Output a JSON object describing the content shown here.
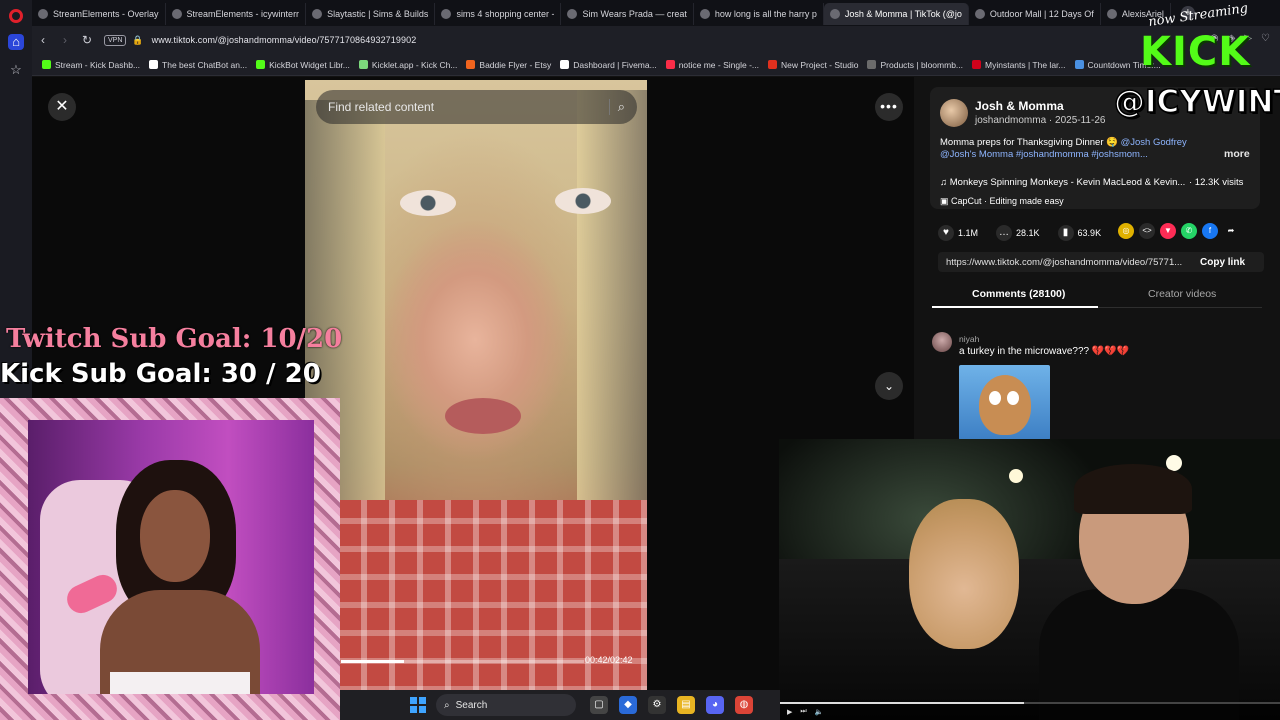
{
  "browser": {
    "tabs": [
      {
        "label": "StreamElements - Overlay",
        "active": false
      },
      {
        "label": "StreamElements - icywinterr",
        "active": false
      },
      {
        "label": "Slaytastic | Sims & Builds",
        "active": false
      },
      {
        "label": "sims 4 shopping center -",
        "active": false
      },
      {
        "label": "Sim Wears Prada — creat",
        "active": false
      },
      {
        "label": "how long is all the harry p",
        "active": false
      },
      {
        "label": "Josh & Momma | TikTok (@jo",
        "active": true
      },
      {
        "label": "Outdoor Mall | 12 Days Of",
        "active": false
      },
      {
        "label": "AlexisAriel",
        "active": false
      }
    ],
    "new_tab": "+",
    "vpn_label": "VPN",
    "url": "www.tiktok.com/@joshandmomma/video/7577170864932719902",
    "bookmarks": [
      {
        "label": "Stream - Kick Dashb...",
        "color": "#53fc18"
      },
      {
        "label": "The best ChatBot an...",
        "color": "#ffffff"
      },
      {
        "label": "KickBot Widget Libr...",
        "color": "#53fc18"
      },
      {
        "label": "Kicklet.app - Kick Ch...",
        "color": "#7cd97c"
      },
      {
        "label": "Baddie Flyer - Etsy",
        "color": "#f1641e"
      },
      {
        "label": "Dashboard | Fivema...",
        "color": "#ffffff"
      },
      {
        "label": "notice me - Single -...",
        "color": "#fa2d48"
      },
      {
        "label": "New Project - Studio",
        "color": "#e0301e"
      },
      {
        "label": "Products | bloommb...",
        "color": "#6b6b6b"
      },
      {
        "label": "Myinstants | The lar...",
        "color": "#d0021b"
      },
      {
        "label": "Countdown Timer...",
        "color": "#4a90e2"
      }
    ]
  },
  "tiktok": {
    "search_placeholder": "Find related content",
    "progress_fraction": 0.26,
    "timecode": "00:42/02:42",
    "author_name": "Josh & Momma",
    "author_handle": "joshandmomma · 2025-11-26",
    "caption_text": "Momma preps for Thanksgiving Dinner 🤤 ",
    "caption_tags_line1": "@Josh Godfrey",
    "caption_tags_line2": "@Josh's Momma #joshandmomma #joshsmom...",
    "more_label": "more",
    "music": "♫  Monkeys Spinning Monkeys - Kevin MacLeod & Kevin...",
    "visits": "· 12.3K visits",
    "capcut": "CapCut · Editing made easy",
    "likes": "1.1M",
    "comments_count": "28.1K",
    "saves": "63.9K",
    "share_link": "https://www.tiktok.com/@joshandmomma/video/75771...",
    "copy_link_label": "Copy link",
    "tab_comments": "Comments (28100)",
    "tab_creator": "Creator videos",
    "comment": {
      "user": "niyah",
      "text": "a turkey in the microwave??? 💔💔💔"
    }
  },
  "overlay": {
    "twitch_goal": "Twitch Sub Goal: 10/20",
    "kick_goal": "Kick Sub Goal: 30 / 20",
    "now_streaming": "now Streaming",
    "kick_brand": "KICK",
    "kick_handle": "@ICYWINTRR"
  },
  "taskbar": {
    "search_label": "Search"
  },
  "colors": {
    "accent_link": "#8eb5ff",
    "kick_green": "#53fc18",
    "twitch_pink": "#f57f9e"
  }
}
